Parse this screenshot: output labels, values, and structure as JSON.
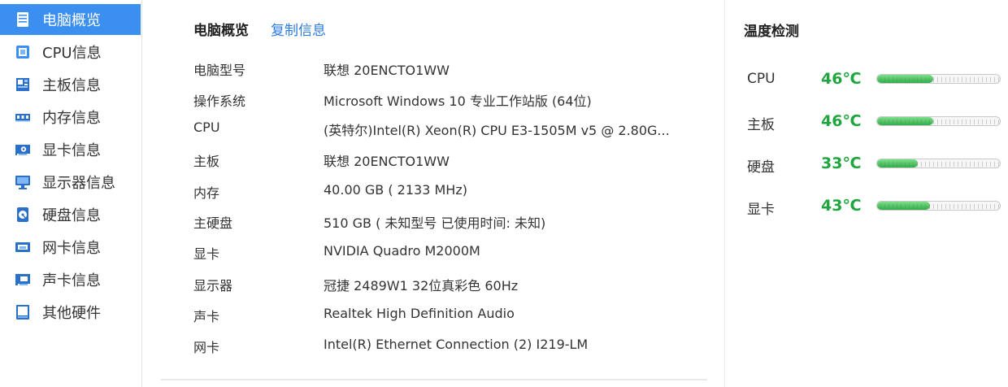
{
  "sidebar": {
    "items": [
      {
        "label": "电脑概览",
        "icon": "computer-overview-icon",
        "active": true
      },
      {
        "label": "CPU信息",
        "icon": "cpu-icon",
        "active": false
      },
      {
        "label": "主板信息",
        "icon": "motherboard-icon",
        "active": false
      },
      {
        "label": "内存信息",
        "icon": "memory-icon",
        "active": false
      },
      {
        "label": "显卡信息",
        "icon": "graphics-card-icon",
        "active": false
      },
      {
        "label": "显示器信息",
        "icon": "monitor-icon",
        "active": false
      },
      {
        "label": "硬盘信息",
        "icon": "hard-disk-icon",
        "active": false
      },
      {
        "label": "网卡信息",
        "icon": "network-card-icon",
        "active": false
      },
      {
        "label": "声卡信息",
        "icon": "sound-card-icon",
        "active": false
      },
      {
        "label": "其他硬件",
        "icon": "other-hardware-icon",
        "active": false
      }
    ]
  },
  "overview": {
    "title": "电脑概览",
    "copy_label": "复制信息",
    "rows": [
      {
        "key": "电脑型号",
        "value": "联想 20ENCTO1WW"
      },
      {
        "key": "操作系统",
        "value": "Microsoft Windows 10 专业工作站版 (64位)"
      },
      {
        "key": "CPU",
        "value": "(英特尔)Intel(R) Xeon(R) CPU E3-1505M v5 @ 2.80G..."
      },
      {
        "key": "主板",
        "value": "联想 20ENCTO1WW"
      },
      {
        "key": "内存",
        "value": "40.00 GB (   2133 MHz)"
      },
      {
        "key": "主硬盘",
        "value": "510 GB ( 未知型号 已使用时间: 未知)"
      },
      {
        "key": "显卡",
        "value": "NVIDIA Quadro M2000M"
      },
      {
        "key": "显示器",
        "value": "冠捷 2489W1 32位真彩色 60Hz"
      },
      {
        "key": "声卡",
        "value": "Realtek High Definition Audio"
      },
      {
        "key": "网卡",
        "value": "Intel(R) Ethernet Connection (2) I219-LM"
      }
    ]
  },
  "temperature": {
    "title": "温度检测",
    "items": [
      {
        "name": "CPU",
        "value": "46℃",
        "level": 0.46
      },
      {
        "name": "主板",
        "value": "46℃",
        "level": 0.46
      },
      {
        "name": "硬盘",
        "value": "33℃",
        "level": 0.33
      },
      {
        "name": "显卡",
        "value": "43℃",
        "level": 0.43
      }
    ]
  },
  "colors": {
    "accent": "#3b8ff0",
    "link": "#2d7be5",
    "temp_good": "#1fa63f"
  }
}
